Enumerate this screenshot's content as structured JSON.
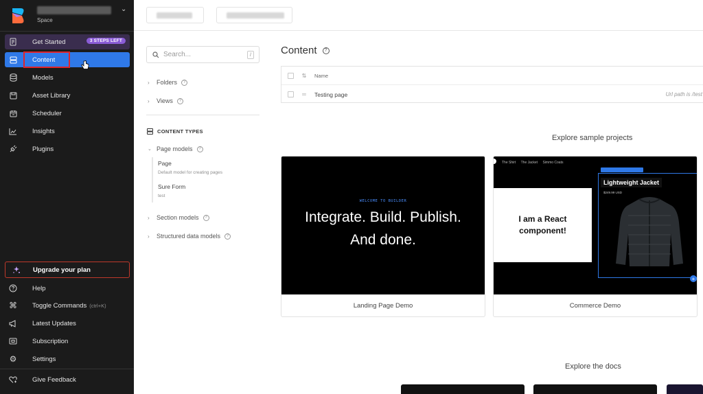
{
  "sidebar": {
    "space_label": "Space",
    "nav_items": [
      {
        "label": "Get Started",
        "icon": "checklist-icon",
        "badge": "3 STEPS LEFT"
      },
      {
        "label": "Content",
        "icon": "content-stack-icon"
      },
      {
        "label": "Models",
        "icon": "database-icon"
      },
      {
        "label": "Asset Library",
        "icon": "image-library-icon"
      },
      {
        "label": "Scheduler",
        "icon": "calendar-icon"
      },
      {
        "label": "Insights",
        "icon": "chart-icon"
      },
      {
        "label": "Plugins",
        "icon": "plug-icon"
      }
    ],
    "upgrade_label": "Upgrade your plan",
    "bottom_items": [
      {
        "label": "Help",
        "icon": "help-circle-icon"
      },
      {
        "label": "Toggle Commands",
        "hint": "(ctrl+K)",
        "icon": "command-key-icon"
      },
      {
        "label": "Latest Updates",
        "icon": "megaphone-icon"
      },
      {
        "label": "Subscription",
        "icon": "card-icon"
      },
      {
        "label": "Settings",
        "icon": "gear-icon"
      },
      {
        "label": "Give Feedback",
        "icon": "feedback-heart-icon"
      }
    ],
    "colors": {
      "background": "#1b1b1b",
      "active": "#2f79e8",
      "badge": "#8a5cd6",
      "highlight": "#e0242a"
    }
  },
  "filters": {
    "search_placeholder": "Search...",
    "search_shortcut": "/",
    "folders_label": "Folders",
    "views_label": "Views",
    "content_types_label": "CONTENT TYPES",
    "page_models_label": "Page models",
    "page_models": [
      {
        "name": "Page",
        "description": "Default model for creating pages"
      },
      {
        "name": "Sure Form",
        "description": "test"
      }
    ],
    "section_models_label": "Section models",
    "structured_data_label": "Structured data models"
  },
  "main": {
    "title": "Content",
    "table": {
      "name_header": "Name",
      "rows": [
        {
          "name": "Testing page",
          "url": "Url path is /test"
        }
      ]
    },
    "samples_heading": "Explore sample projects",
    "samples": [
      {
        "caption": "Landing Page Demo",
        "welcome": "WELCOME TO BUILDER",
        "headline_1": "Integrate. Build. Publish.",
        "headline_2": "And done."
      },
      {
        "caption": "Commerce Demo",
        "nav": [
          "The Shirt",
          "The Jacket",
          "Simmo Coats"
        ],
        "react_line_1": "I am a React",
        "react_line_2": "component!",
        "product_title": "Lightweight Jacket",
        "price": "$249.99 USD"
      }
    ],
    "docs_heading": "Explore the docs"
  }
}
